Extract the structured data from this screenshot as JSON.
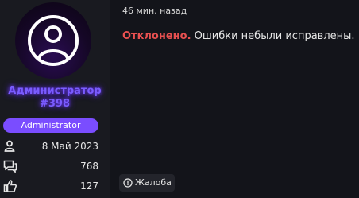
{
  "user": {
    "name_line1": "Администратор",
    "name_line2": "#398",
    "role": "Administrator",
    "avatar_icon": "user-circle-icon",
    "accent_color": "#7a4dff"
  },
  "stats": [
    {
      "icon": "user-icon",
      "value": "8 Май 2023"
    },
    {
      "icon": "messages-icon",
      "value": "768"
    },
    {
      "icon": "thumbs-up-icon",
      "value": "127"
    }
  ],
  "post": {
    "time": "46 мин. назад",
    "status": "Отклонено.",
    "status_color": "#e85050",
    "message": " Ошибки небыли исправлены."
  },
  "actions": {
    "report_icon": "warning-circle-icon",
    "report_label": "Жалоба"
  }
}
